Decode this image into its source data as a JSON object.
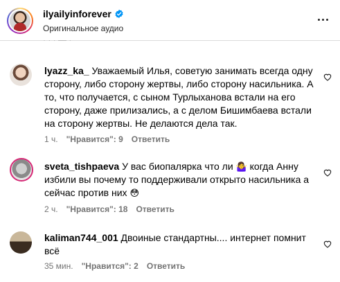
{
  "header": {
    "username": "ilyailyinforever",
    "subtitle": "Оригинальное аудио"
  },
  "comments": [
    {
      "user": "lyazz_ka_",
      "text": "Уважаемый Илья, советую занимать всегда одну сторону, либо сторону жертвы, либо сторону насильника. А то, что получается, с сыном Турлыханова встали на его сторону, даже прилизались, а с делом Бишимбаева встали на сторону жертвы. Не делаются дела так.",
      "time": "1 ч.",
      "likes": "\"Нравится\": 9",
      "reply": "Ответить"
    },
    {
      "user": "sveta_tishpaeva",
      "text": "У вас биопалярка что ли",
      "text2": "когда Анну избили вы почему то поддерживали открыто насильника а сейчас против них",
      "time": "2 ч.",
      "likes": "\"Нравится\": 18",
      "reply": "Ответить"
    },
    {
      "user": "kaliman744_001",
      "text": "Двоиные стандартны.... интернет помнит всё",
      "time": "35 мин.",
      "likes": "\"Нравится\": 2",
      "reply": "Ответить"
    }
  ],
  "icons": {
    "verified": "verified-badge-icon",
    "more": "more-options-icon",
    "like": "heart-icon"
  },
  "colors": {
    "verified": "#0095f6",
    "meta": "#737373",
    "divider": "#dbdbdb"
  }
}
